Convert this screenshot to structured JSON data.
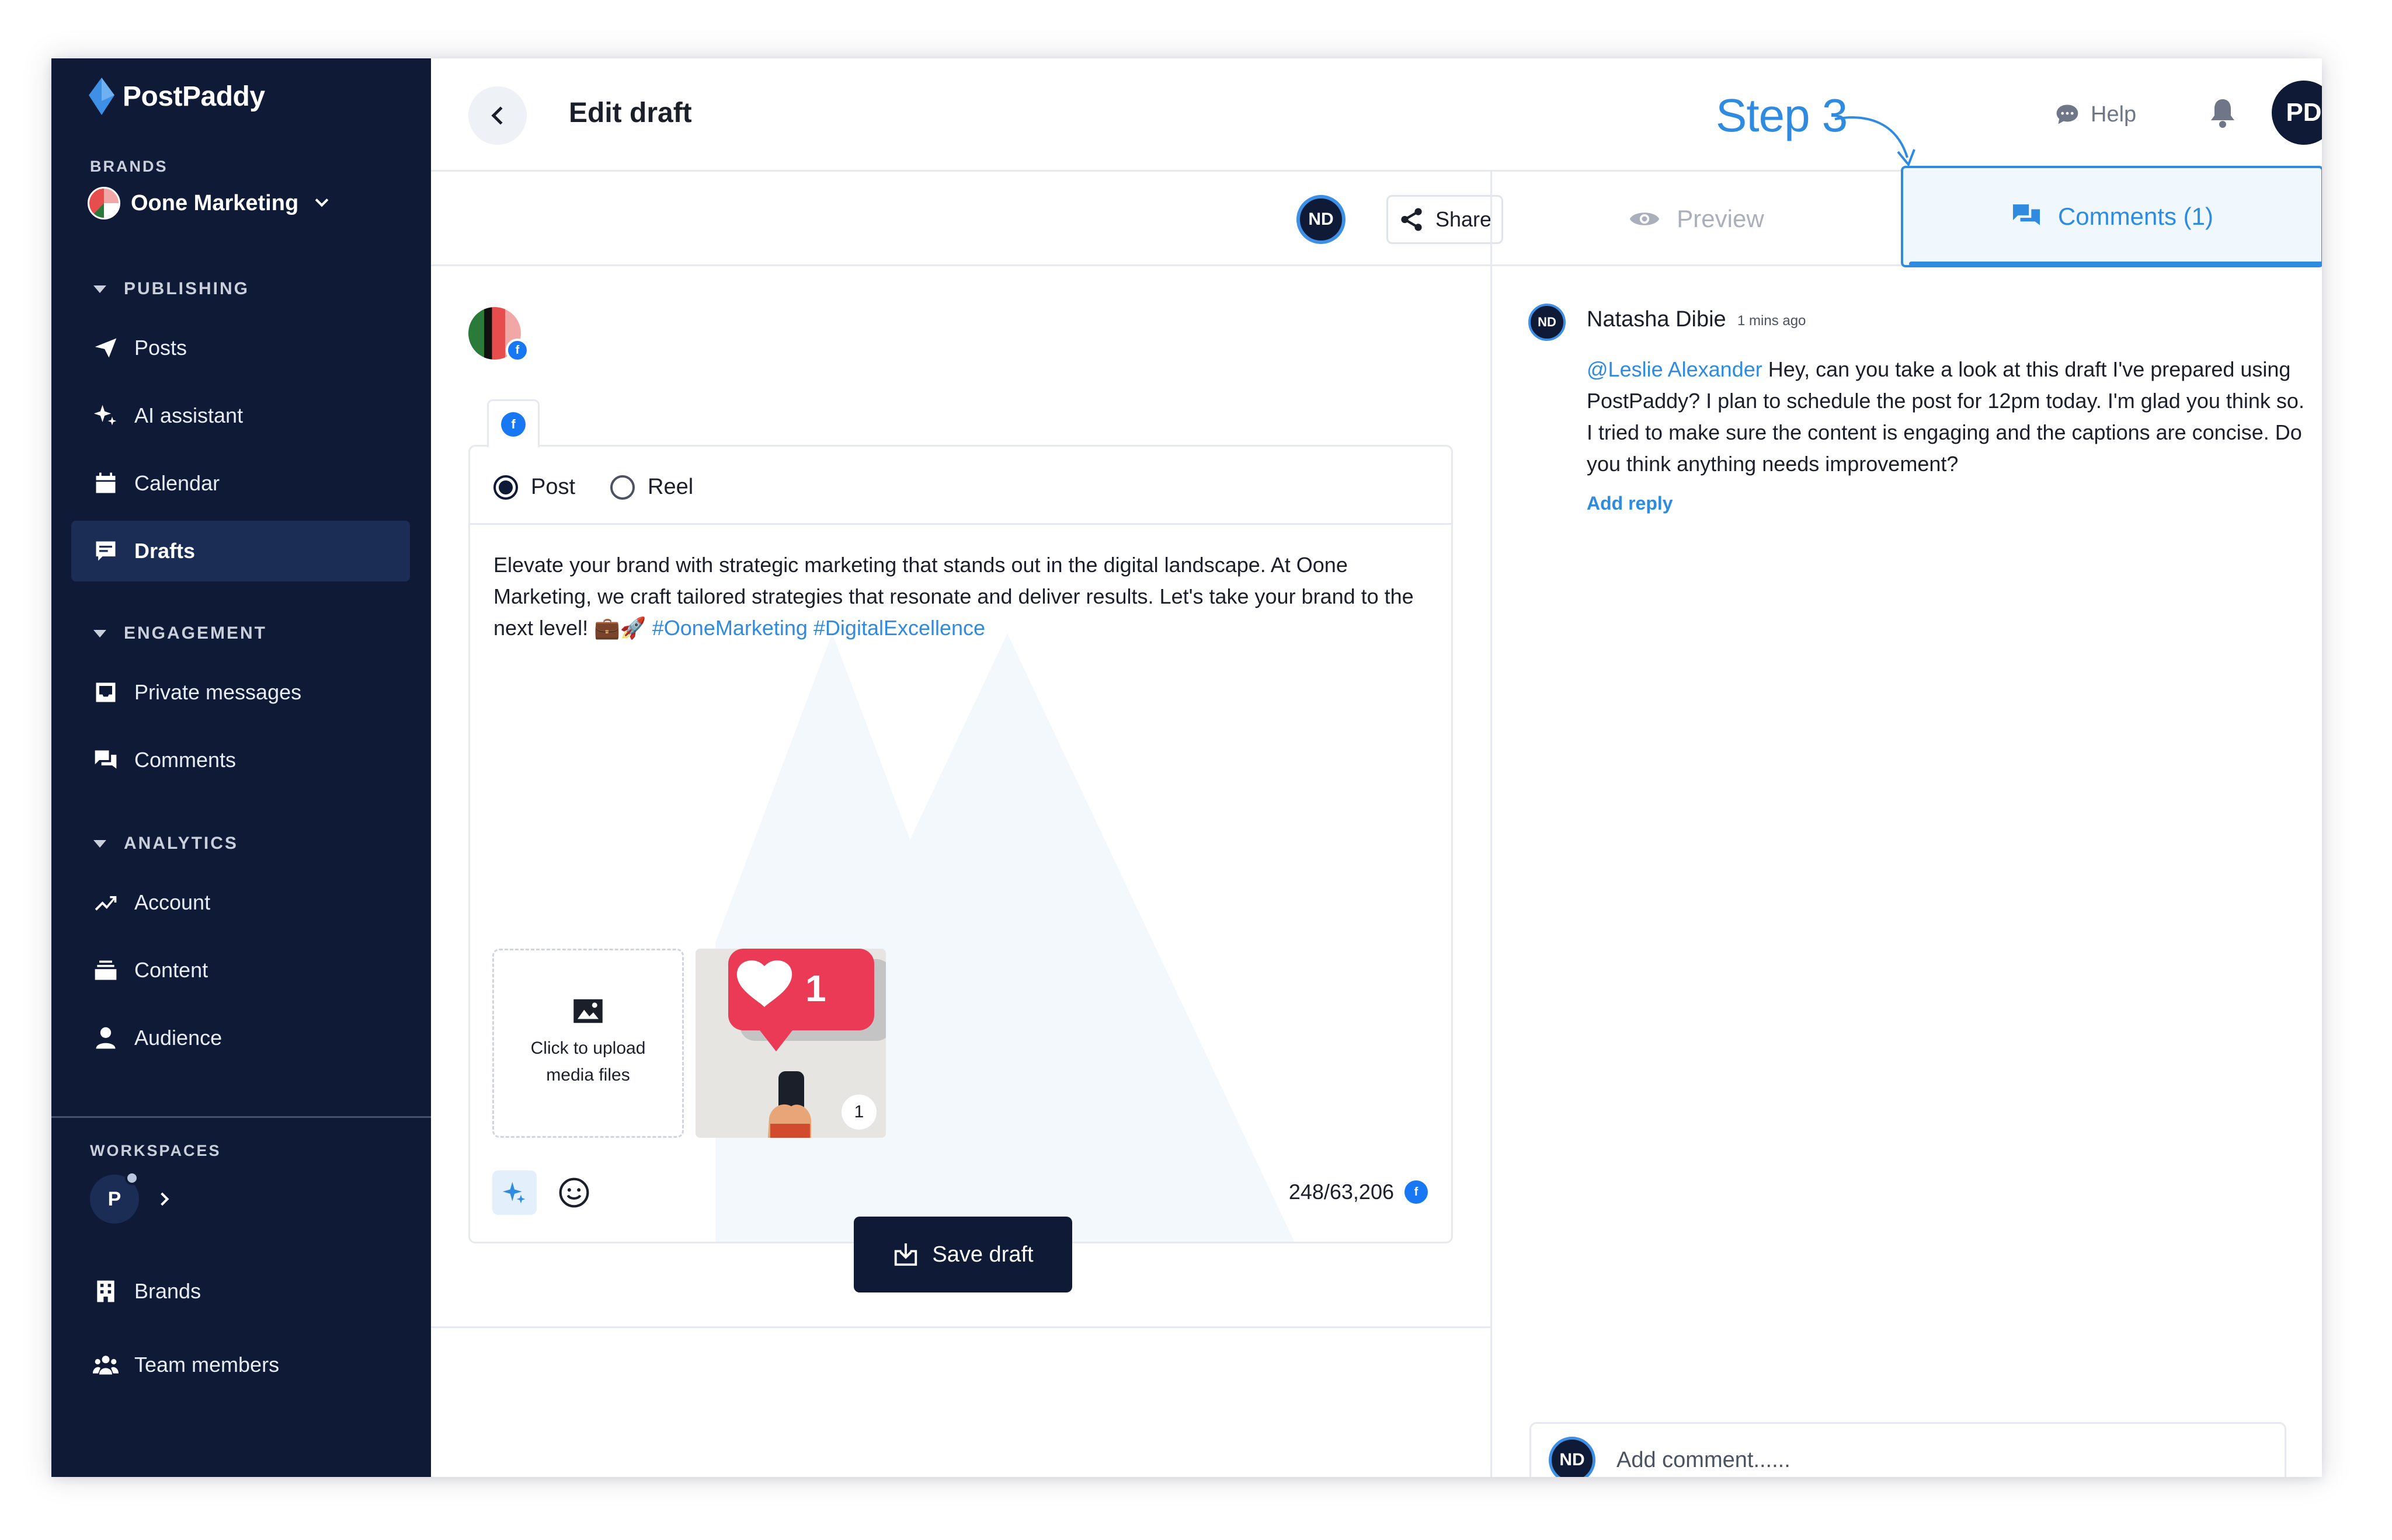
{
  "app": {
    "name": "PostPaddy"
  },
  "sidebar": {
    "brands_label": "BRANDS",
    "brand_name": "Oone Marketing",
    "publishing_label": "PUBLISHING",
    "publishing_items": [
      {
        "label": "Posts",
        "icon": "paper-plane-icon"
      },
      {
        "label": "AI assistant",
        "icon": "sparkle-icon"
      },
      {
        "label": "Calendar",
        "icon": "calendar-icon"
      },
      {
        "label": "Drafts",
        "icon": "drafts-icon",
        "active": true
      }
    ],
    "engagement_label": "ENGAGEMENT",
    "engagement_items": [
      {
        "label": "Private messages",
        "icon": "inbox-icon"
      },
      {
        "label": "Comments",
        "icon": "comments-icon"
      }
    ],
    "analytics_label": "ANALYTICS",
    "analytics_items": [
      {
        "label": "Account",
        "icon": "trend-icon"
      },
      {
        "label": "Content",
        "icon": "stack-icon"
      },
      {
        "label": "Audience",
        "icon": "person-icon"
      }
    ],
    "workspaces_label": "WORKSPACES",
    "workspace_initial": "P",
    "footer_items": [
      {
        "label": "Brands",
        "icon": "building-icon"
      },
      {
        "label": "Team members",
        "icon": "team-icon"
      }
    ]
  },
  "header": {
    "title": "Edit draft",
    "step_label": "Step 3",
    "help_label": "Help",
    "user_initials": "PD"
  },
  "toolbar": {
    "collaborator_initials": "ND",
    "share_label": "Share"
  },
  "tabs": {
    "preview_label": "Preview",
    "comments_label": "Comments (1)"
  },
  "editor": {
    "network_icon": "f",
    "post_type_options": [
      "Post",
      "Reel"
    ],
    "selected_type": "Post",
    "text_plain": "Elevate your brand with strategic marketing that stands out in the digital landscape. At Oone Marketing, we craft tailored strategies that resonate and deliver results. Let's take your brand to the next level! 💼🚀 ",
    "hashtags": "#OoneMarketing #DigitalExcellence",
    "upload_line1": "Click to upload",
    "upload_line2": "media files",
    "media_count": "1",
    "thumb_like_count": "1",
    "char_count": "248/63,206",
    "save_label": "Save draft"
  },
  "comments": {
    "items": [
      {
        "initials": "ND",
        "author": "Natasha Dibie",
        "time": "1 mins ago",
        "mention": "@Leslie Alexander",
        "body": " Hey, can you take a look at this draft I've prepared using PostPaddy? I plan to schedule the post for 12pm today. I'm glad you think so. I tried to make sure the content is engaging and the captions are concise. Do you think anything needs improvement?",
        "reply_label": "Add reply"
      }
    ],
    "input_initials": "ND",
    "input_placeholder": "Add comment......"
  },
  "colors": {
    "sidebar_bg": "#0e1a36",
    "accent": "#2f8be0",
    "facebook": "#1877f2"
  }
}
